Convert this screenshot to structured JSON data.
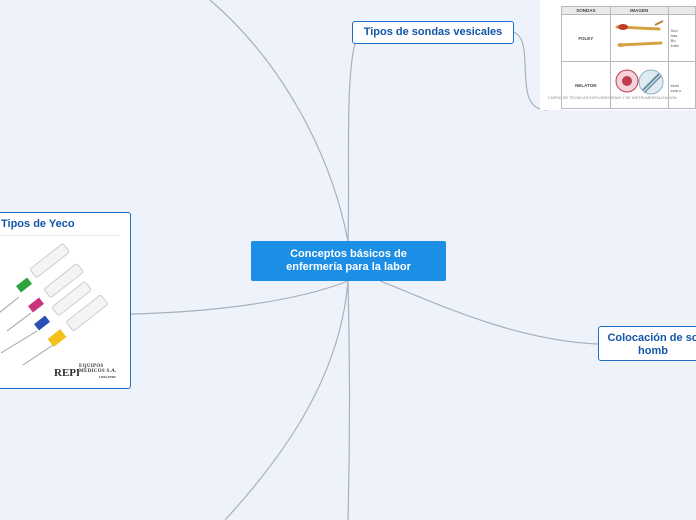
{
  "map": {
    "central_topic": {
      "line1": "Conceptos básicos de",
      "line2": "enfermería para la labor"
    },
    "topics": {
      "sondas": "Tipos de sondas vesicales",
      "coloc_line1": "Colocación de so",
      "coloc_line2": "homb",
      "yeco": "Tipos de Yeco"
    },
    "sondas_image": {
      "headers": [
        "SONDAS",
        "IMAGEN",
        ""
      ],
      "rows": [
        {
          "name": "FOLEY",
          "desc": [
            "Son",
            "tras",
            "Bo",
            "indiv"
          ]
        },
        {
          "name": "NELATON",
          "desc": [
            "",
            "semi",
            "sola u"
          ]
        }
      ],
      "caption": "CURSO DE TÉCNICAS EXPLORATORIAS Y DE INSTRUMENTALIZACIÓN"
    },
    "yeco_image": {
      "logo_mark": "REPR",
      "logo_line1": "EQUIPOS",
      "logo_line2": "MÉDICOS S.A.",
      "logo_line3": "LIMA-PERU"
    },
    "colors": {
      "background": "#eef3fb",
      "central_fill": "#1c8ee6",
      "node_border": "#1f6fc5",
      "node_text": "#1456a8",
      "connector": "#a8b0bc",
      "catheter_colors": [
        "#2fa33b",
        "#c9357a",
        "#2b4fb5",
        "#f2c11a"
      ]
    }
  }
}
